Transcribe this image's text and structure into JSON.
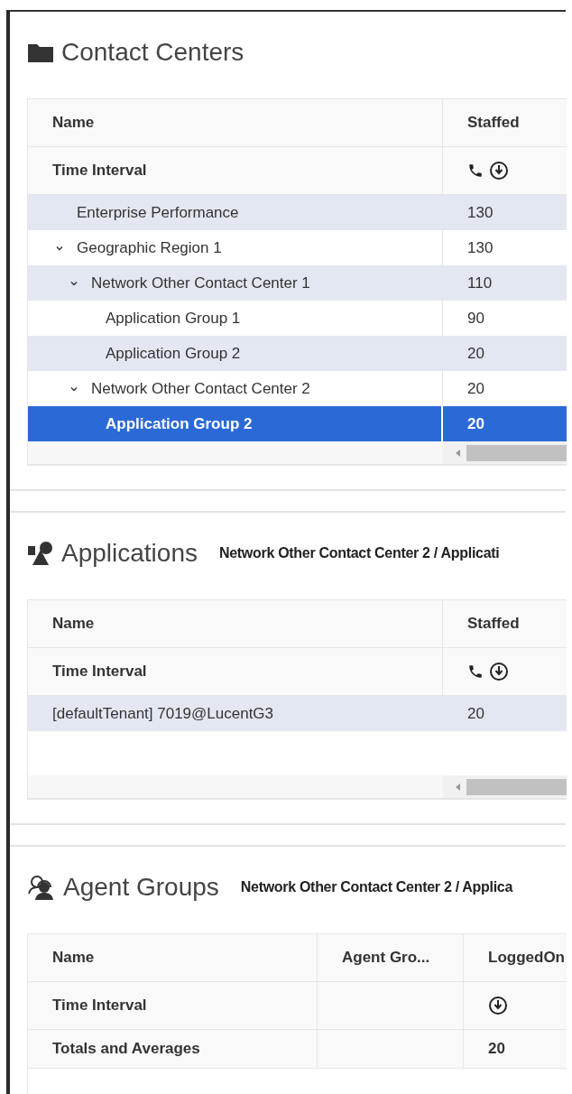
{
  "sections": [
    {
      "kind": "contact_centers",
      "title": "Contact Centers",
      "columns": [
        {
          "label": "Name"
        },
        {
          "label": "Staffed",
          "kind": "calls"
        }
      ],
      "interval_label": "Time Interval",
      "scrollbar": true,
      "rows": [
        {
          "name": "Enterprise Performance",
          "values": [
            "130"
          ],
          "selected": false
        },
        {
          "name": "Geographic Region 1",
          "values": [
            "130"
          ],
          "selected": false,
          "expanded": true,
          "children": [
            {
              "name": "Network Other Contact Center 1",
              "values": [
                "110"
              ],
              "selected": false,
              "expanded": true,
              "children": [
                {
                  "name": "Application Group 1",
                  "values": [
                    "90"
                  ],
                  "selected": false
                },
                {
                  "name": "Application Group 2",
                  "values": [
                    "20"
                  ],
                  "selected": false
                }
              ]
            },
            {
              "name": "Network Other Contact Center 2",
              "values": [
                "20"
              ],
              "selected": false,
              "expanded": true,
              "children": [
                {
                  "name": "Application Group 2",
                  "values": [
                    "20"
                  ],
                  "selected": true
                }
              ]
            }
          ]
        }
      ]
    },
    {
      "kind": "applications",
      "title": "Applications",
      "breadcrumb": "Network Other Contact Center 2 / Applicati",
      "columns": [
        {
          "label": "Name"
        },
        {
          "label": "Staffed",
          "kind": "calls"
        }
      ],
      "interval_label": "Time Interval",
      "scrollbar": true,
      "rows": [
        {
          "name": "[defaultTenant] 7019@LucentG3",
          "values": [
            "20"
          ],
          "selected": false
        }
      ]
    },
    {
      "kind": "agent_groups",
      "title": "Agent Groups",
      "breadcrumb": "Network Other Contact Center 2 / Applica",
      "columns": [
        {
          "label": "Name"
        },
        {
          "label": "Agent Gro..."
        },
        {
          "label": "LoggedOn",
          "kind": "agents",
          "total": "20"
        }
      ],
      "interval_label": "Time Interval",
      "totals_label": "Totals and Averages"
    }
  ]
}
